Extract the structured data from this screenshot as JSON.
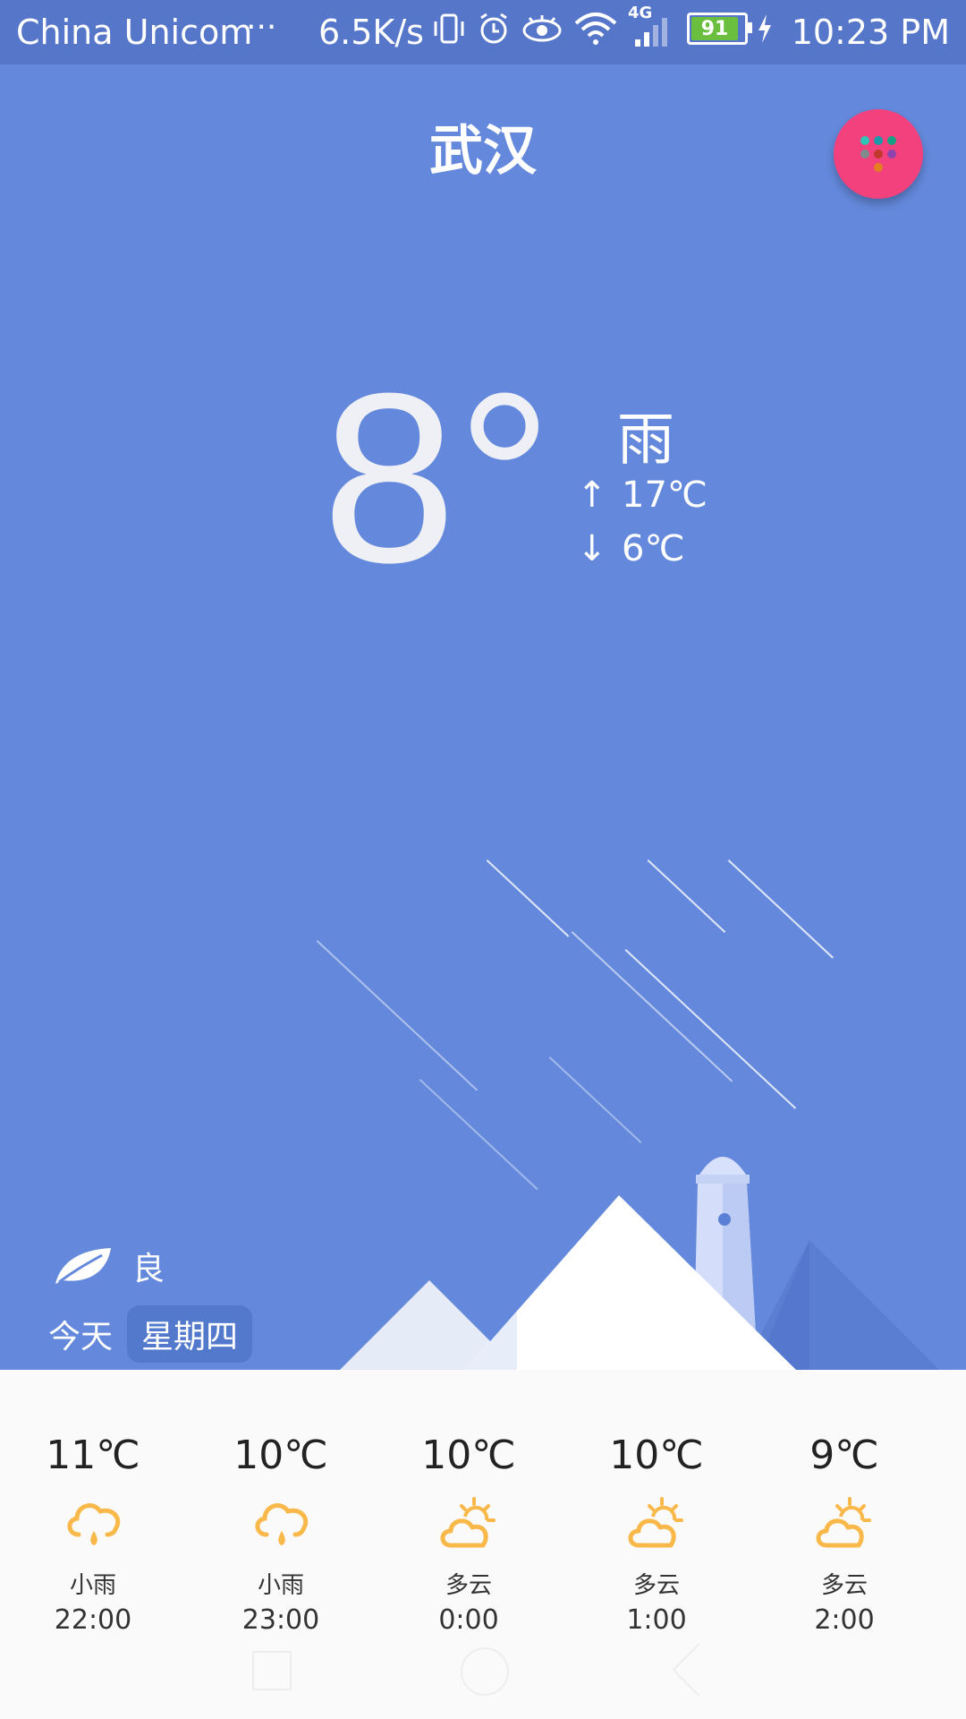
{
  "status_bar": {
    "carrier": "China Unicom",
    "dots": "···",
    "speed": "6.5K/s",
    "network": "4G",
    "battery": "91",
    "time": "10:23 PM"
  },
  "city": "武汉",
  "current": {
    "temp": "8°",
    "condition": "雨",
    "high": "17℃",
    "low": "6℃",
    "up_arrow": "↑",
    "down_arrow": "↓"
  },
  "air_quality": "良",
  "today_label": "今天",
  "weekday": "星期四",
  "forecast": [
    {
      "temp": "11℃",
      "icon": "light-rain-icon",
      "desc": "小雨",
      "time": "22:00"
    },
    {
      "temp": "10℃",
      "icon": "light-rain-icon",
      "desc": "小雨",
      "time": "23:00"
    },
    {
      "temp": "10℃",
      "icon": "partly-cloudy-icon",
      "desc": "多云",
      "time": "0:00"
    },
    {
      "temp": "10℃",
      "icon": "partly-cloudy-icon",
      "desc": "多云",
      "time": "1:00"
    },
    {
      "temp": "9℃",
      "icon": "partly-cloudy-icon",
      "desc": "多云",
      "time": "2:00"
    }
  ],
  "colors": {
    "sky": "#6489dc",
    "status_bar": "#5676c9",
    "fab": "#f2417d",
    "icon_yellow": "#f9b84a"
  }
}
